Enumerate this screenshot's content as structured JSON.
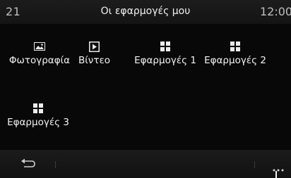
{
  "status": {
    "left": "21",
    "title": "Οι εφαρμογές μου",
    "right": "12:00"
  },
  "apps": [
    {
      "label": "Φωτογραφία",
      "icon": "photo-icon"
    },
    {
      "label": "Βίντεο",
      "icon": "video-icon"
    },
    {
      "label": "Εφαρμογές 1",
      "icon": "app-grid-icon"
    },
    {
      "label": "Εφαρμογές 2",
      "icon": "app-grid-icon"
    },
    {
      "label": "Εφαρμογές 3",
      "icon": "app-grid-icon"
    }
  ],
  "bottom": {
    "back_icon": "back-arrow-icon",
    "more_icon": "more-dots-icon"
  },
  "colors": {
    "background": "#080808",
    "bar": "#161616",
    "text": "#f2f2f2"
  }
}
